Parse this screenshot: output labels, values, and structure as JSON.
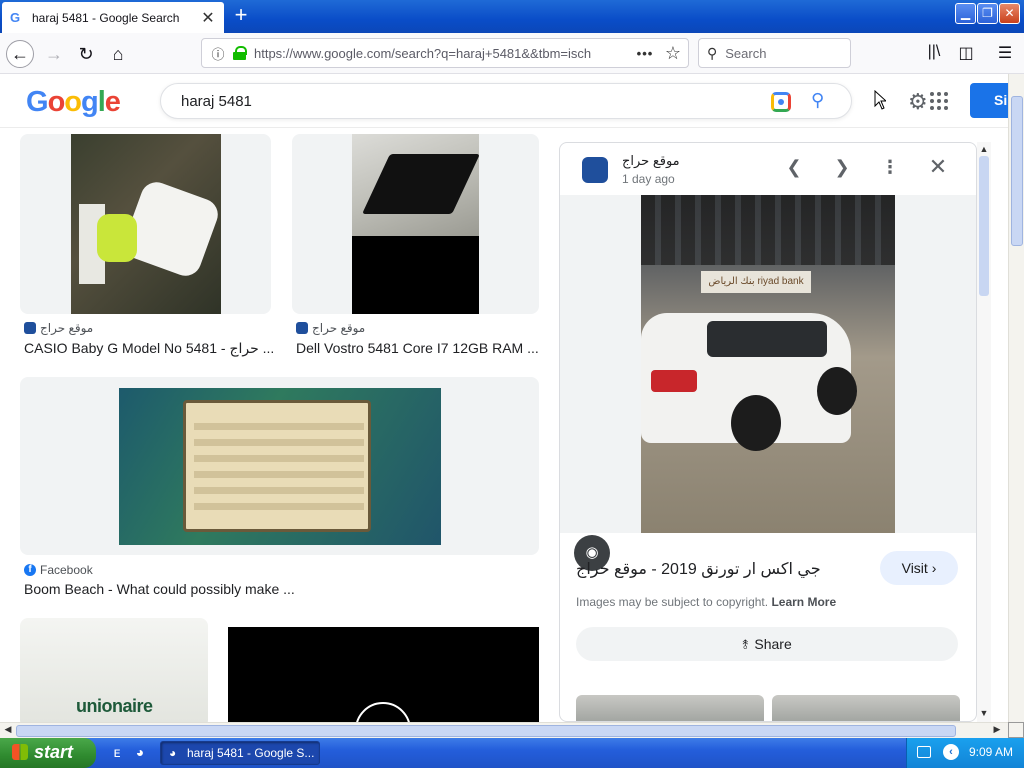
{
  "browser": {
    "tab_title": "haraj 5481 - Google Search",
    "tab_favicon": "G",
    "tab_close": "✕",
    "new_tab": "+",
    "window_controls": {
      "minimize": "▁",
      "maximize": "❐",
      "close": "✕"
    },
    "url": "https://www.google.com/search?q=haraj+5481&&tbm=isch",
    "url_overflow_dots": "•••",
    "search_placeholder": "Search",
    "accent_color": "#0a4dc8"
  },
  "google": {
    "logo": {
      "l1": "G",
      "l2": "o",
      "l3": "o",
      "l4": "g",
      "l5": "l",
      "l6": "e"
    },
    "query": "haraj 5481",
    "signin_label": "Si"
  },
  "results": [
    {
      "source": "موقع حراج",
      "title": "CASIO Baby G Model No 5481 - حراج ..."
    },
    {
      "source": "موقع حراج",
      "title": "Dell Vostro 5481 Core I7 12GB RAM ..."
    },
    {
      "source": "Facebook",
      "title": "Boom Beach - What could possibly make ..."
    },
    {
      "brand_text": "unionaire"
    }
  ],
  "preview": {
    "site": "موقع حراج",
    "time": "1 day ago",
    "image_sign": "بنك الرياض  riyad bank",
    "title": "جي اكس ار تورنق 2019 - موقع حراج",
    "visit_label": "Visit",
    "copyright": "Images may be subject to copyright.",
    "learn_more": "Learn More",
    "share_label": "Share"
  },
  "taskbar": {
    "start_label": "start",
    "task_label": "haraj 5481 - Google S...",
    "clock": "9:09 AM"
  }
}
